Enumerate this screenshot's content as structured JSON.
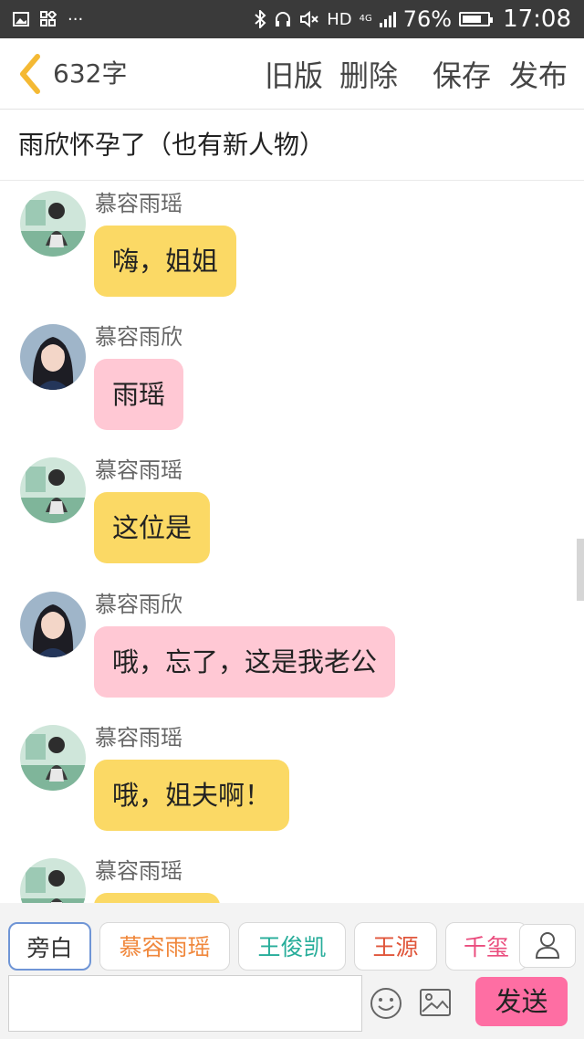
{
  "status_bar": {
    "network": "HD",
    "net_tag": "4G",
    "battery_percent": "76%",
    "battery_level": 0.76,
    "time": "17:08",
    "more": "···"
  },
  "header": {
    "word_count": "632字",
    "actions": {
      "old_version": "旧版",
      "delete": "删除",
      "save": "保存",
      "publish": "发布"
    }
  },
  "title": "雨欣怀孕了（也有新人物）",
  "messages": [
    {
      "speaker": "慕容雨瑶",
      "text": "嗨，姐姐",
      "bubble_color": "#fbd965"
    },
    {
      "speaker": "慕容雨欣",
      "text": "雨瑶",
      "bubble_color": "#ffc8d4"
    },
    {
      "speaker": "慕容雨瑶",
      "text": "这位是",
      "bubble_color": "#fbd965"
    },
    {
      "speaker": "慕容雨欣",
      "text": "哦，忘了，这是我老公",
      "bubble_color": "#ffc8d4"
    },
    {
      "speaker": "慕容雨瑶",
      "text": "哦，姐夫啊！",
      "bubble_color": "#fbd965"
    },
    {
      "speaker": "慕容雨瑶",
      "text": "",
      "bubble_color": "#fbd965"
    }
  ],
  "composer": {
    "role_tabs": [
      {
        "label": "旁白",
        "color": "#333333"
      },
      {
        "label": "慕容雨瑶",
        "color": "#f0883d"
      },
      {
        "label": "王俊凯",
        "color": "#27ad9a"
      },
      {
        "label": "王源",
        "color": "#e0563b"
      },
      {
        "label": "千玺",
        "color": "#ea4d7e"
      }
    ],
    "input_value": "",
    "send_label": "发送",
    "icons": {
      "person": "person-icon",
      "emoji": "emoji-icon",
      "image": "image-icon"
    }
  },
  "colors": {
    "narrator_selected_border": "#6f95d6",
    "send_button": "#fe6ea3",
    "status_bar_bg": "#3a3a3a"
  }
}
